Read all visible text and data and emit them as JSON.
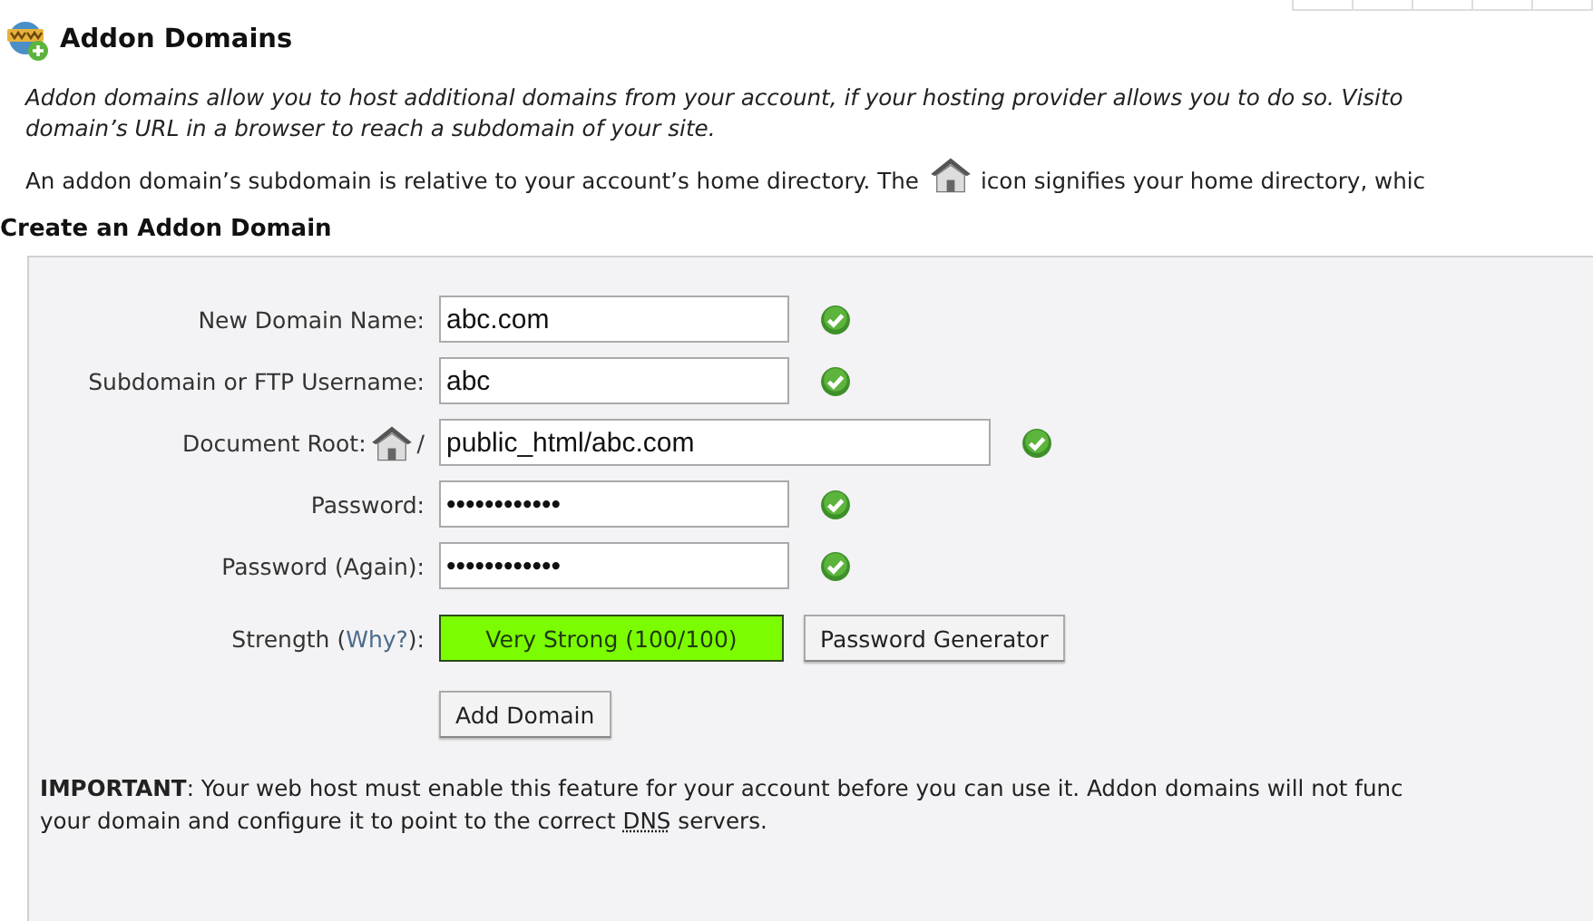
{
  "title": "Addon Domains",
  "intro_lines": [
    "Addon domains allow you to host additional domains from your account, if your hosting provider allows you to do so. Visito",
    "domain’s URL in a browser to reach a subdomain of your site."
  ],
  "home_note": {
    "before": "An addon domain’s subdomain is relative to your account’s home directory. The",
    "after": "icon signifies your home directory, whic"
  },
  "form": {
    "heading": "Create an Addon Domain",
    "fields": [
      {
        "kind": "text",
        "label": "New Domain Name:",
        "value": "abc.com",
        "valid": true
      },
      {
        "kind": "text",
        "label": "Subdomain or FTP Username:",
        "value": "abc",
        "valid": true
      },
      {
        "kind": "docroot",
        "label": "Document Root:",
        "prefix": "/",
        "value": "public_html/abc.com",
        "valid": true
      },
      {
        "kind": "text",
        "label": "Password:",
        "value": "••••••••••••",
        "valid": true
      },
      {
        "kind": "text",
        "label": "Password (Again):",
        "value": "••••••••••••",
        "valid": true
      }
    ],
    "strength": {
      "label": "Strength (",
      "link": "Why?",
      "label_end": "):",
      "meter_text": "Very Strong (100/100)",
      "level": 1.0,
      "generator_button": "Password Generator"
    },
    "submit_button": "Add Domain",
    "important_lines": [
      "**IMPORTANT**: Your web host must enable this feature for your account before you can use it. Addon domains will not func"
    ],
    "important_last": {
      "before": "your domain and configure it to point to the correct",
      "abbr": "DNS",
      "after": "servers."
    }
  }
}
